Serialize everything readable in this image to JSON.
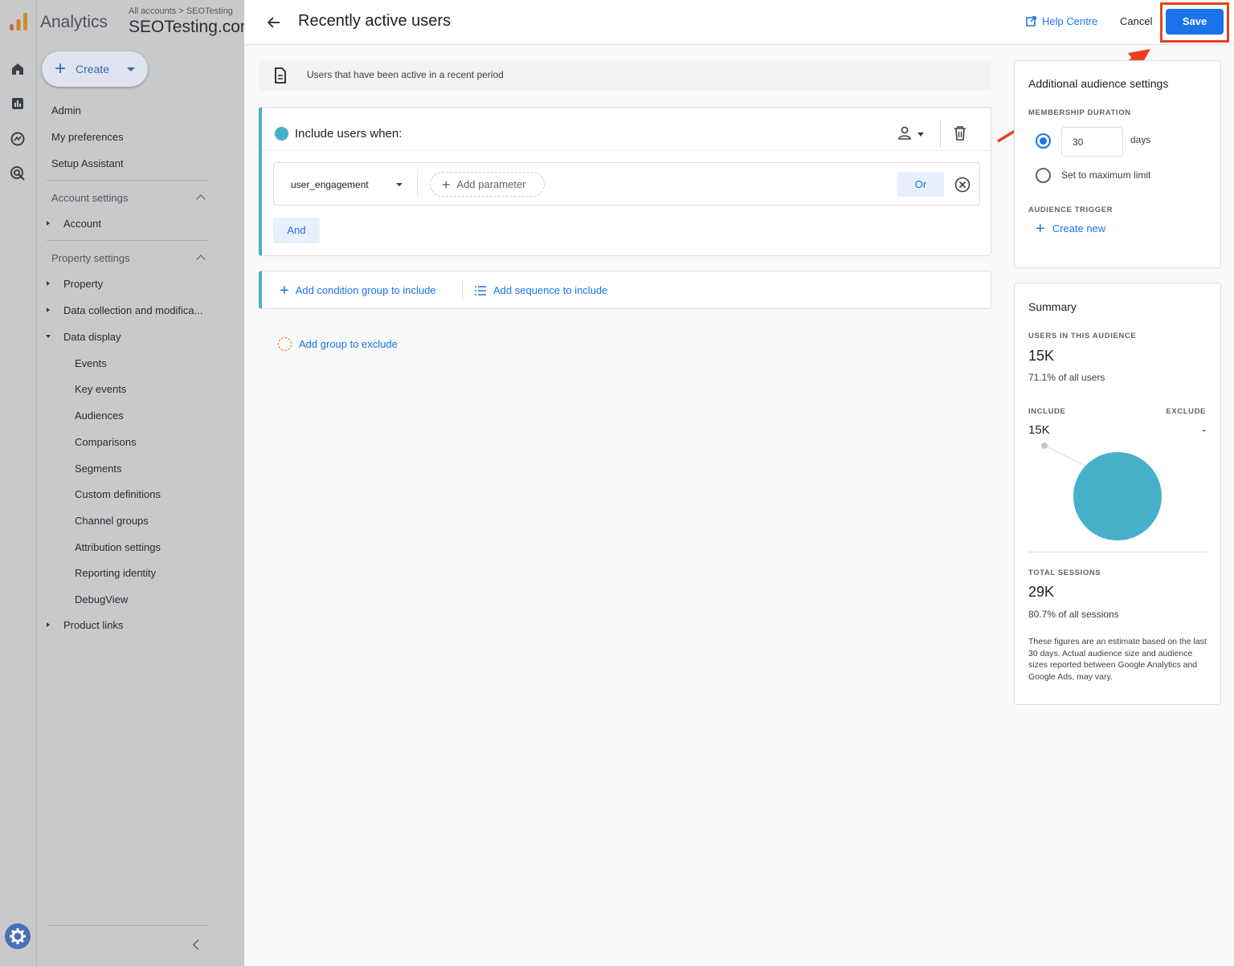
{
  "nav": {
    "brand": "Analytics",
    "breadcrumb": "All accounts > SEOTesting",
    "property": "SEOTesting.com",
    "create_label": "Create",
    "admin": "Admin",
    "my_preferences": "My preferences",
    "setup_assistant": "Setup Assistant",
    "account_settings": "Account settings",
    "account": "Account",
    "property_settings": "Property settings",
    "property_item": "Property",
    "data_collection": "Data collection and modifica...",
    "data_display": "Data display",
    "data_display_items": [
      "Events",
      "Key events",
      "Audiences",
      "Comparisons",
      "Segments",
      "Custom definitions",
      "Channel groups",
      "Attribution settings",
      "Reporting identity",
      "DebugView"
    ],
    "product_links": "Product links"
  },
  "header": {
    "title": "Recently active users",
    "help": "Help Centre",
    "cancel": "Cancel",
    "save": "Save"
  },
  "description": "Users that have been active in a recent period",
  "condition": {
    "include_label": "Include users when:",
    "event": "user_engagement",
    "add_parameter": "Add parameter",
    "or": "Or",
    "and": "And"
  },
  "add_condition_group": "Add condition group to include",
  "add_sequence": "Add sequence to include",
  "add_exclude": "Add group to exclude",
  "settings": {
    "title": "Additional audience settings",
    "membership_caption": "MEMBERSHIP DURATION",
    "days_value": "30",
    "days_label": "days",
    "max_limit": "Set to maximum limit",
    "trigger_caption": "AUDIENCE TRIGGER",
    "create_new": "Create new"
  },
  "summary": {
    "title": "Summary",
    "users_caption": "USERS IN THIS AUDIENCE",
    "users_value": "15K",
    "users_pct": "71.1% of all users",
    "include_caption": "INCLUDE",
    "exclude_caption": "EXCLUDE",
    "include_value": "15K",
    "exclude_value": "-",
    "sessions_caption": "TOTAL SESSIONS",
    "sessions_value": "29K",
    "sessions_pct": "80.7% of all sessions",
    "note": "These figures are an estimate based on the last 30 days. Actual audience size and audience sizes reported between Google Analytics and Google Ads, may vary."
  },
  "colors": {
    "accent": "#1a73e8",
    "condition": "#46b0c8",
    "highlight": "#e8421b"
  }
}
